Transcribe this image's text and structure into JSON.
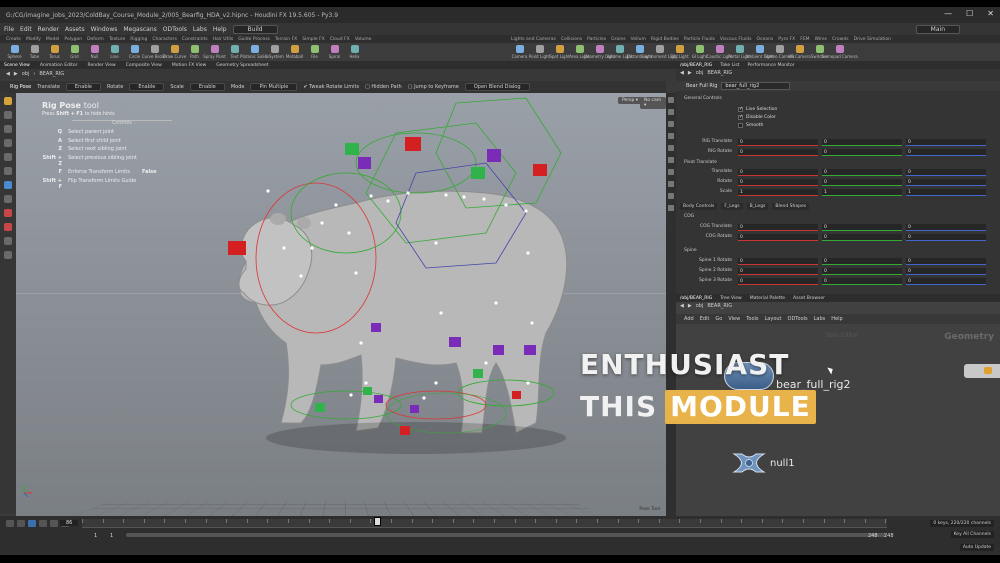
{
  "window": {
    "title": "G:/CG/imagine_jobs_2023/ColdBay_Course_Module_2/005_Bearfig_HDA_v2.hipnc - Houdini FX 19.5.605 - Py3.9",
    "controls": [
      "—",
      "☐",
      "✕"
    ]
  },
  "menubar": {
    "items": [
      "File",
      "Edit",
      "Render",
      "Assets",
      "Windows",
      "Megascans",
      "ODTools",
      "Labs",
      "Help"
    ],
    "build": "Build",
    "desktop": "Main"
  },
  "shelf_tabs_left": [
    "Create",
    "Modify",
    "Model",
    "Polygon",
    "Deform",
    "Texture",
    "Rigging",
    "Characters",
    "Constraints",
    "Hair Utils",
    "Guide Process",
    "Terrain FX",
    "Simple FX",
    "Cloud FX",
    "Volume"
  ],
  "shelf_tabs_right": [
    "Lights and Cameras",
    "Collisions",
    "Particles",
    "Grains",
    "Vellum",
    "Rigid Bodies",
    "Particle Fluids",
    "Viscous Fluids",
    "Oceans",
    "Pyro FX",
    "FEM",
    "Wires",
    "Crowds",
    "Drive Simulation"
  ],
  "shelf_tools_left": [
    "Sphere",
    "Tube",
    "Torus",
    "Grid",
    "Null",
    "Line",
    "Circle",
    "Curve Bezier",
    "Draw Curve",
    "Path",
    "Spray Paint",
    "Text",
    "Platonic Solids",
    "L-System",
    "Metaball",
    "File",
    "Spiral",
    "Helix"
  ],
  "shelf_tools_right": [
    "Camera",
    "Point Light",
    "Spot Light",
    "Area Light",
    "Geometry Light",
    "Volume Light",
    "Distant Light",
    "Environment Light",
    "Sky Light",
    "GI Light",
    "Caustic Light",
    "Portal Light",
    "Ambient Light",
    "Stereo Camera",
    "VR Camera",
    "Switcher",
    "Gamepad Camera"
  ],
  "viewer_tabs": [
    "Scene View",
    "Animation Editor",
    "Render View",
    "Composite View",
    "Motion FX View",
    "Geometry Spreadsheet"
  ],
  "path": {
    "root": "obj",
    "node": "BEAR_RIG"
  },
  "tool_options": {
    "pose": "Rig Pose",
    "translate_label": "Translate",
    "translate_val": "Enable",
    "rotate_label": "Rotate",
    "rotate_val": "Enable",
    "scale_label": "Scale",
    "scale_val": "Enable",
    "mode_label": "Mode",
    "mode_val": "Pin Multiple",
    "tweak": "Tweak Rotate Limits",
    "hidden": "Hidden Path",
    "jump": "Jump to Keyframe",
    "dialog": "Open Blend Dialog"
  },
  "hud": {
    "title_bold": "Rig Pose",
    "title_rest": "tool",
    "sub_pre": "Press",
    "sub_key": "Shift + F1",
    "sub_post": "to hide hints",
    "controls": "Controls",
    "lines": [
      {
        "key": "Q",
        "desc": "Select parent joint",
        "val": ""
      },
      {
        "key": "A",
        "desc": "Select first child joint",
        "val": ""
      },
      {
        "key": "Z",
        "desc": "Select next sibling joint",
        "val": ""
      },
      {
        "key": "Shift + Z",
        "desc": "Select previous sibling joint",
        "val": ""
      },
      {
        "key": "F",
        "desc": "Enforce Transform Limits",
        "val": "False"
      },
      {
        "key": "Shift + F",
        "desc": "Flip Transform Limits Guide",
        "val": ""
      }
    ]
  },
  "viewport": {
    "persp": "Persp ▾",
    "cam": "No cam ▾",
    "bottom_right": "Pose Tool",
    "accent_green": "#2fb34a",
    "accent_red": "#d42020",
    "accent_purple": "#7a2bb8"
  },
  "param_panel": {
    "tabs": [
      "/obj/BEAR_RIG",
      "Take List",
      "Performance Monitor"
    ],
    "node_type": "Bear Full Rig",
    "node_name": "bear_full_rig2",
    "general": "General Controls",
    "checks": [
      {
        "label": "Live Selection",
        "on": true
      },
      {
        "label": "Disable Color",
        "on": true
      },
      {
        "label": "Smooth",
        "on": false
      }
    ],
    "rows_top": [
      {
        "label": "RIG Translate",
        "v": [
          "0",
          "0",
          "0"
        ]
      },
      {
        "label": "RIG Rotate",
        "v": [
          "0",
          "0",
          "0"
        ]
      }
    ],
    "pivot": "Pivot Translate",
    "rows_mid": [
      {
        "label": "Translate",
        "v": [
          "0",
          "0",
          "0"
        ]
      },
      {
        "label": "Rotate",
        "v": [
          "0",
          "0",
          "0"
        ]
      },
      {
        "label": "Scale",
        "v": [
          "1",
          "1",
          "1"
        ]
      }
    ],
    "subtabs": [
      "Body Controls",
      "F_Legs",
      "B_Legs",
      "Blend Shapes"
    ],
    "cog": "COG",
    "rows_cog": [
      {
        "label": "COG Translate",
        "v": [
          "0",
          "0",
          "0"
        ]
      },
      {
        "label": "COG Rotate",
        "v": [
          "0",
          "0",
          "0"
        ]
      }
    ],
    "spine": "Spine",
    "rows_spine": [
      {
        "label": "Spine 1 Rotate",
        "v": [
          "0",
          "0",
          "0"
        ]
      },
      {
        "label": "Spine 2 Rotate",
        "v": [
          "0",
          "0",
          "0"
        ]
      },
      {
        "label": "Spine 3 Rotate",
        "v": [
          "0",
          "0",
          "0"
        ]
      }
    ]
  },
  "network": {
    "tabs": [
      "/obj/BEAR_RIG",
      "Tree View",
      "Material Palette",
      "Asset Browser"
    ],
    "path_root": "obj",
    "path_node": "BEAR_RIG",
    "menu": [
      "Add",
      "Edit",
      "Go",
      "View",
      "Tools",
      "Layout",
      "ODTools",
      "Labs",
      "Help"
    ],
    "context": "Geometry",
    "sub": "Solo Editor",
    "node1": "bear_full_rig2",
    "node2": "null1"
  },
  "overlay": {
    "line1": "ENTHUSIAST",
    "line2_a": "THIS",
    "line2_b": "MODULE",
    "highlight_color": "#e8b34a"
  },
  "timeline": {
    "frame": "86",
    "start": "1",
    "start2": "1",
    "end": "248",
    "end2": "248",
    "keys": "0 keys, 220/220 channels",
    "all": "Key All Channels",
    "auto": "Auto Update"
  }
}
